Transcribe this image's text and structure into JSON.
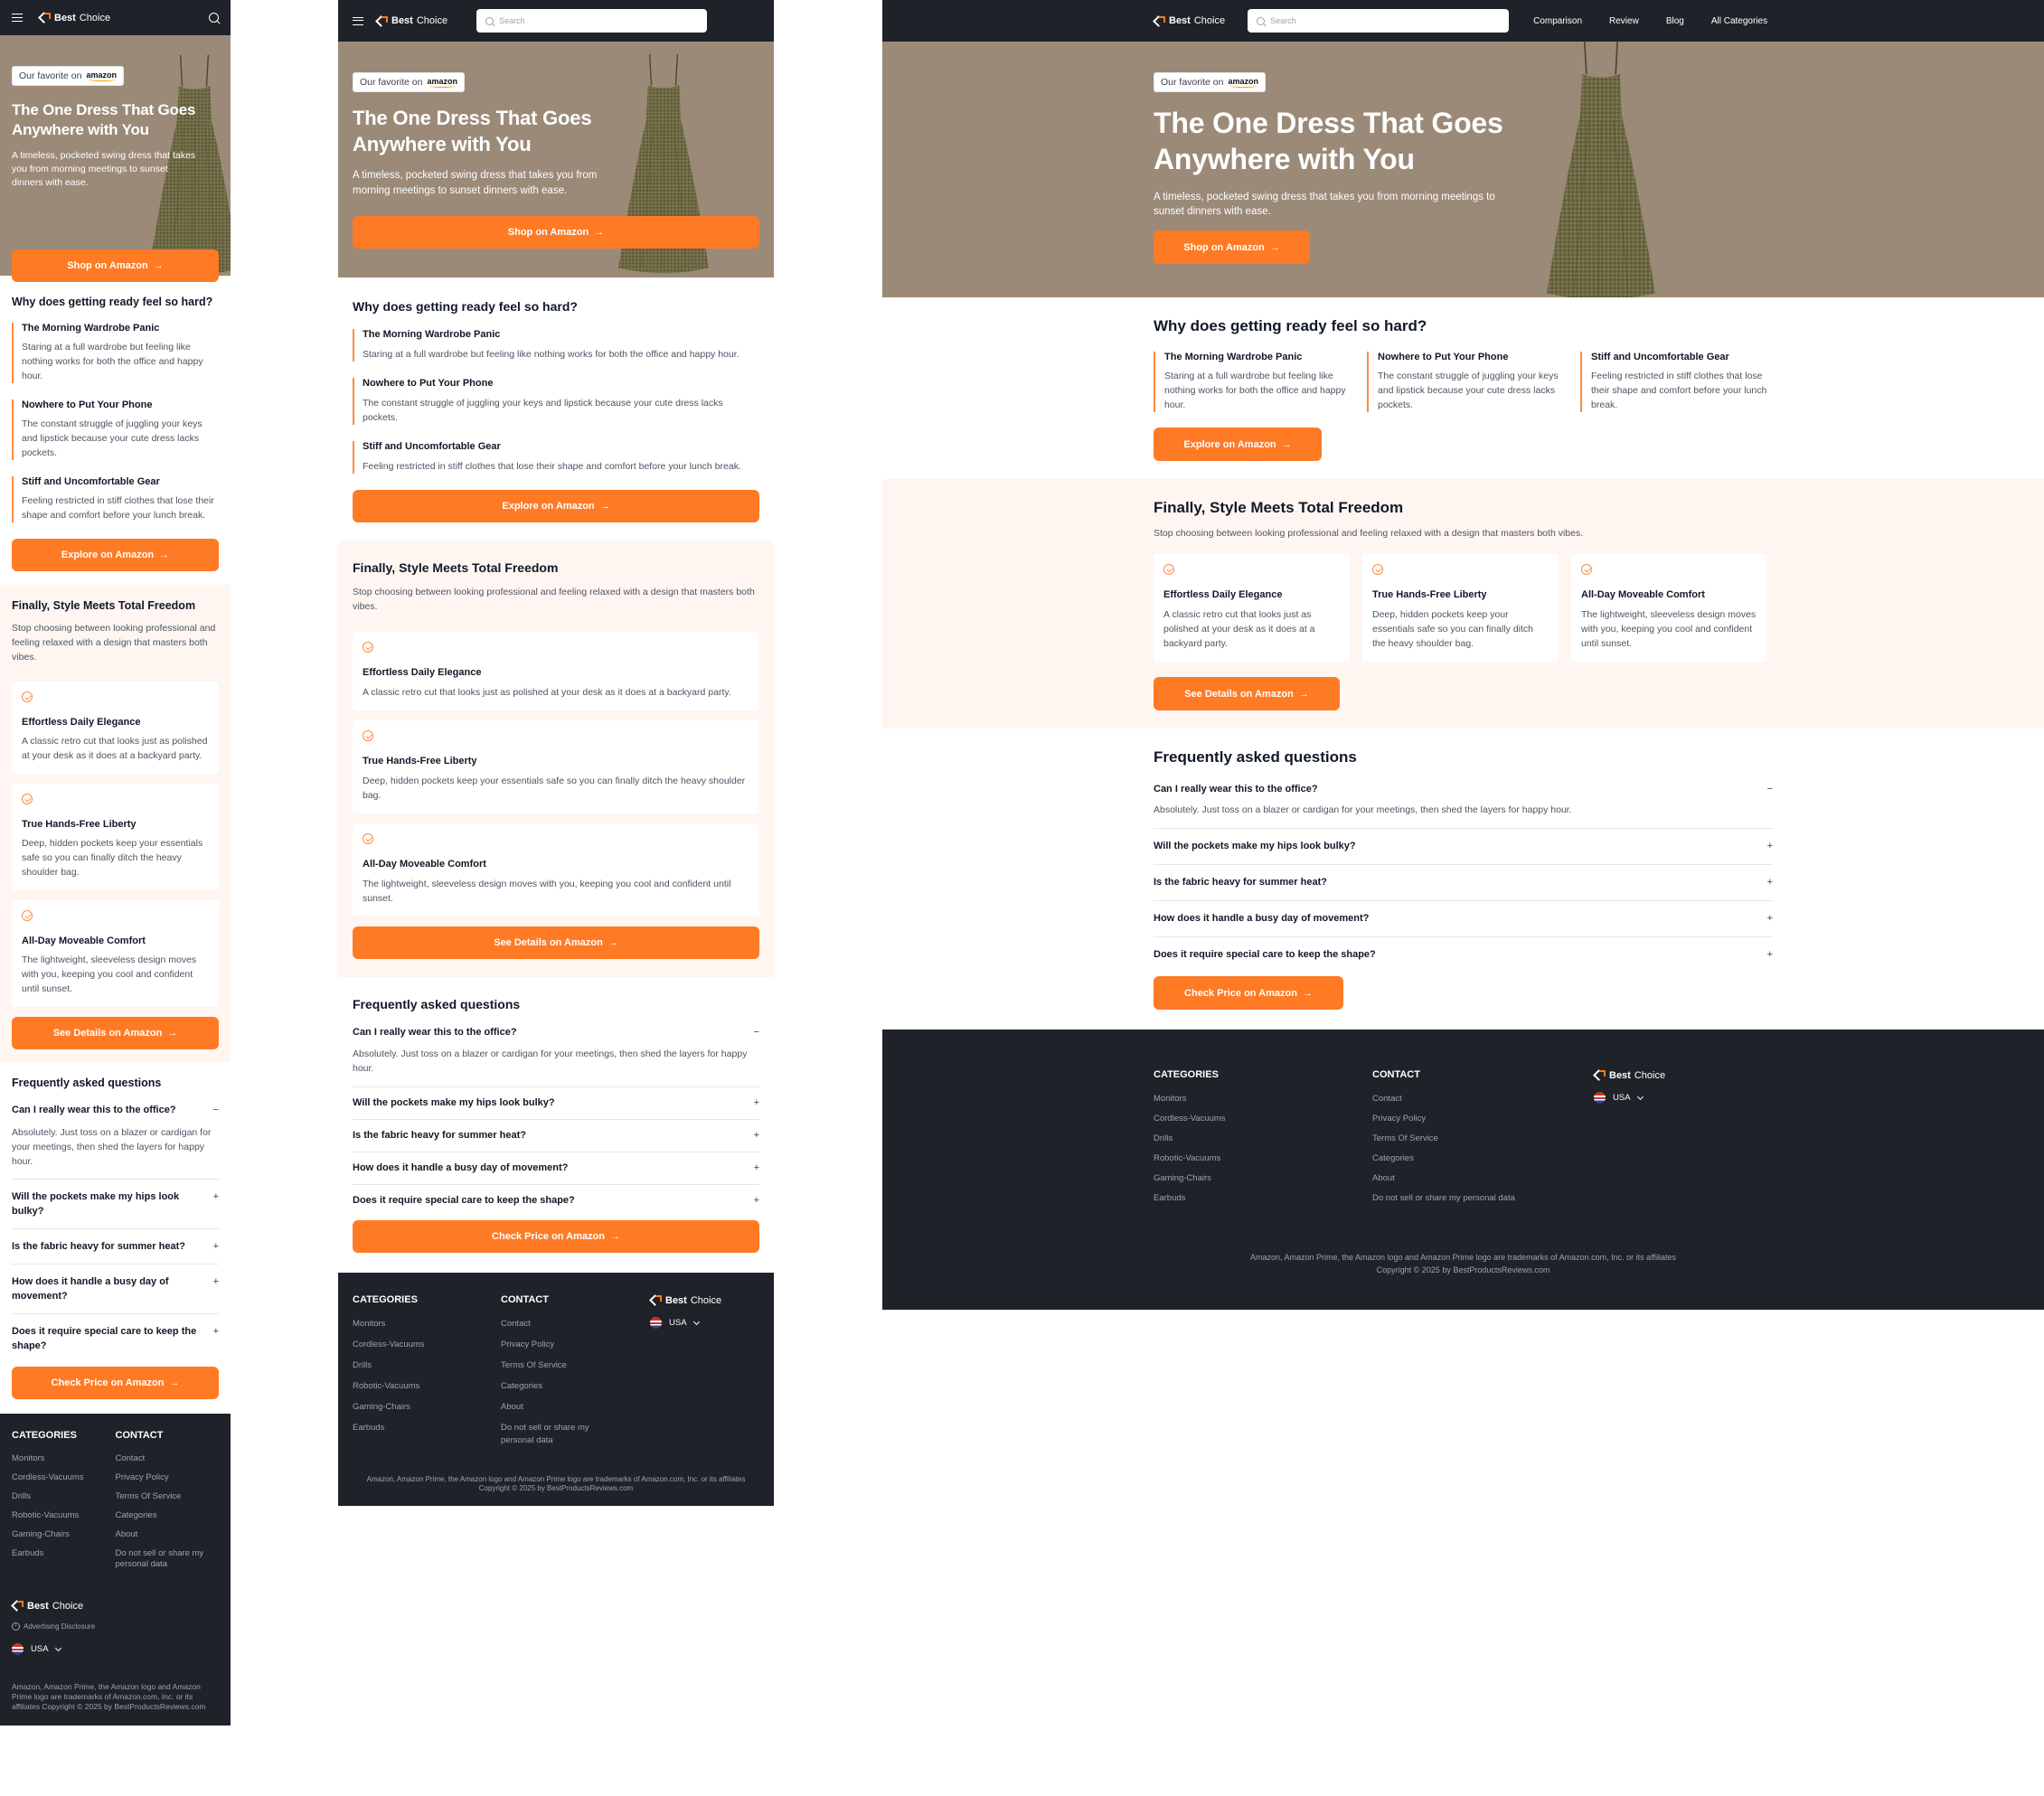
{
  "brand": {
    "bold": "Best",
    "rest": "Choice"
  },
  "search": {
    "placeholder": "Search"
  },
  "nav": [
    "Comparison",
    "Review",
    "Blog",
    "All Categories"
  ],
  "hero": {
    "chip_label": "Our favorite on",
    "chip_brand": "amazon",
    "title": "The One Dress That Goes Anywhere with You",
    "subtitle": "A timeless, pocketed swing dress that takes you from morning meetings to sunset dinners with ease.",
    "cta": "Shop on Amazon"
  },
  "problems": {
    "title": "Why does getting ready feel so hard?",
    "items": [
      {
        "title": "The Morning Wardrobe Panic",
        "text": "Staring at a full wardrobe but feeling like nothing works for both the office and happy hour."
      },
      {
        "title": "Nowhere to Put Your Phone",
        "text": "The constant struggle of juggling your keys and lipstick because your cute dress lacks pockets."
      },
      {
        "title": "Stiff and Uncomfortable Gear",
        "text": "Feeling restricted in stiff clothes that lose their shape and comfort before your lunch break."
      }
    ],
    "cta": "Explore on Amazon"
  },
  "solution": {
    "title": "Finally, Style Meets Total Freedom",
    "intro": "Stop choosing between looking professional and feeling relaxed with a design that masters both vibes.",
    "items": [
      {
        "title": "Effortless Daily Elegance",
        "text": "A classic retro cut that looks just as polished at your desk as it does at a backyard party."
      },
      {
        "title": "True Hands-Free Liberty",
        "text": "Deep, hidden pockets keep your essentials safe so you can finally ditch the heavy shoulder bag."
      },
      {
        "title": "All-Day Moveable Comfort",
        "text": "The lightweight, sleeveless design moves with you, keeping you cool and confident until sunset."
      }
    ],
    "cta": "See Details on Amazon"
  },
  "faq": {
    "title": "Frequently asked questions",
    "items": [
      {
        "q": "Can I really wear this to the office?",
        "a": "Absolutely. Just toss on a blazer or cardigan for your meetings, then shed the layers for happy hour.",
        "open": true
      },
      {
        "q": "Will the pockets make my hips look bulky?",
        "open": false
      },
      {
        "q": "Is the fabric heavy for summer heat?",
        "open": false
      },
      {
        "q": "How does it handle a busy day of movement?",
        "open": false
      },
      {
        "q": "Does it require special care to keep the shape?",
        "open": false
      }
    ],
    "cta": "Check Price on Amazon"
  },
  "footer": {
    "categories_title": "CATEGORIES",
    "categories": [
      "Monitors",
      "Cordless-Vacuums",
      "Drills",
      "Robotic-Vacuums",
      "Gaming-Chairs",
      "Earbuds"
    ],
    "contact_title": "CONTACT",
    "contact": [
      "Contact",
      "Privacy Policy",
      "Terms Of Service",
      "Categories",
      "About",
      "Do not sell or share my personal data"
    ],
    "disclosure": "Advertising Disclosure",
    "country": "USA",
    "trademark": "Amazon, Amazon Prime, the Amazon logo and Amazon Prime logo are trademarks of Amazon.com, Inc. or its affiliates",
    "copyright": "Copyright © 2025 by BestProductsReviews.com"
  },
  "icons": {
    "arrow": "→",
    "minus": "−",
    "plus": "+"
  },
  "colors": {
    "accent": "#ff7a24",
    "dark": "#1f2229",
    "hero_bg": "#9b8a78",
    "tint": "#fff6f1"
  }
}
